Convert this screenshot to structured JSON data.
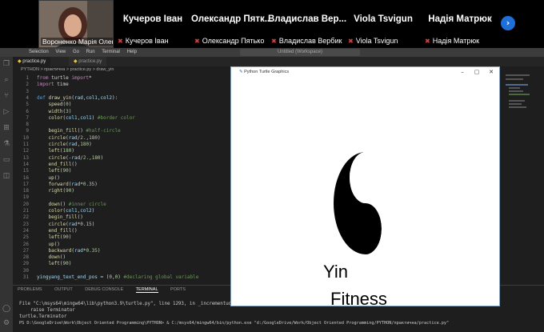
{
  "call": {
    "main_participant": "Вороненко Марія Олекса...",
    "participants": [
      {
        "name": "Кучеров Іван",
        "tag": "Кучеров Іван"
      },
      {
        "name": "Олександр Пятк...",
        "tag": "Олександр Пятько"
      },
      {
        "name": "Владислав Вер...",
        "tag": "Владислав Вербик"
      },
      {
        "name": "Viola Tsvigun",
        "tag": "Viola Tsvigun"
      },
      {
        "name": "Надія Матрюк",
        "tag": "Надія Матрюк"
      }
    ],
    "next_icon": "chevron-right-icon"
  },
  "vscode": {
    "menu": [
      "Selection",
      "View",
      "Go",
      "Run",
      "Terminal",
      "Help"
    ],
    "window_title": "Untitled (Workspace)",
    "tabs": [
      "practice.py",
      "practice.py"
    ],
    "breadcrumb": "PYTHON > практична > practice.py > draw_yin",
    "panel_tabs": [
      "PROBLEMS",
      "OUTPUT",
      "DEBUG CONSOLE",
      "TERMINAL",
      "PORTS"
    ],
    "terminal": [
      "File \"C:\\msys64\\mingw64\\lib\\python3.9\\turtle.py\", line 1293, in _incrementudc",
      "    raise Terminator",
      "turtle.Terminator",
      "PS D:\\GoogleDrive\\Work\\Object Oriented Programming\\PYTHON> & C:/msys64/mingw64/bin/python.exe \"d:/GoogleDrive/Work/Object Oriented Programming/PYTHON/практична/practice.py\""
    ]
  },
  "turtle": {
    "title": "Python Turtle Graphics",
    "text1": "Yin",
    "text2": "Fitness"
  },
  "code": [
    {
      "n": "1",
      "parts": [
        [
          "kw",
          "from "
        ],
        [
          "plain",
          "turtle "
        ],
        [
          "kw",
          "import"
        ],
        [
          "plain",
          "*"
        ]
      ]
    },
    {
      "n": "2",
      "parts": [
        [
          "kw",
          "import "
        ],
        [
          "plain",
          "time"
        ]
      ]
    },
    {
      "n": "3",
      "parts": []
    },
    {
      "n": "4",
      "parts": [
        [
          "df",
          "def "
        ],
        [
          "fn",
          "draw_yin"
        ],
        [
          "plain",
          "("
        ],
        [
          "var",
          "rad"
        ],
        [
          "plain",
          ","
        ],
        [
          "var",
          "col1"
        ],
        [
          "plain",
          ","
        ],
        [
          "var",
          "col2"
        ],
        [
          "plain",
          "):"
        ]
      ]
    },
    {
      "n": "5",
      "parts": [
        [
          "plain",
          "    "
        ],
        [
          "fn",
          "speed"
        ],
        [
          "plain",
          "("
        ],
        [
          "nm",
          "0"
        ],
        [
          "plain",
          ")"
        ]
      ]
    },
    {
      "n": "6",
      "parts": [
        [
          "plain",
          "    "
        ],
        [
          "fn",
          "width"
        ],
        [
          "plain",
          "("
        ],
        [
          "nm",
          "3"
        ],
        [
          "plain",
          ")"
        ]
      ]
    },
    {
      "n": "7",
      "parts": [
        [
          "plain",
          "    "
        ],
        [
          "fn",
          "color"
        ],
        [
          "plain",
          "("
        ],
        [
          "var",
          "col1"
        ],
        [
          "plain",
          ","
        ],
        [
          "var",
          "col1"
        ],
        [
          "plain",
          ") "
        ],
        [
          "cm",
          "#border color"
        ]
      ]
    },
    {
      "n": "8",
      "parts": []
    },
    {
      "n": "9",
      "parts": [
        [
          "plain",
          "    "
        ],
        [
          "fn",
          "begin_fill"
        ],
        [
          "plain",
          "() "
        ],
        [
          "cm",
          "#half-circle"
        ]
      ]
    },
    {
      "n": "10",
      "parts": [
        [
          "plain",
          "    "
        ],
        [
          "fn",
          "circle"
        ],
        [
          "plain",
          "("
        ],
        [
          "var",
          "rad"
        ],
        [
          "plain",
          "/"
        ],
        [
          "nm",
          "2."
        ],
        [
          "plain",
          ","
        ],
        [
          "nm",
          "180"
        ],
        [
          "plain",
          ")"
        ]
      ]
    },
    {
      "n": "11",
      "parts": [
        [
          "plain",
          "    "
        ],
        [
          "fn",
          "circle"
        ],
        [
          "plain",
          "("
        ],
        [
          "var",
          "rad"
        ],
        [
          "plain",
          ","
        ],
        [
          "nm",
          "180"
        ],
        [
          "plain",
          ")"
        ]
      ]
    },
    {
      "n": "12",
      "parts": [
        [
          "plain",
          "    "
        ],
        [
          "fn",
          "left"
        ],
        [
          "plain",
          "("
        ],
        [
          "nm",
          "180"
        ],
        [
          "plain",
          ")"
        ]
      ]
    },
    {
      "n": "13",
      "parts": [
        [
          "plain",
          "    "
        ],
        [
          "fn",
          "circle"
        ],
        [
          "plain",
          "(-"
        ],
        [
          "var",
          "rad"
        ],
        [
          "plain",
          "/"
        ],
        [
          "nm",
          "2."
        ],
        [
          "plain",
          ","
        ],
        [
          "nm",
          "180"
        ],
        [
          "plain",
          ")"
        ]
      ]
    },
    {
      "n": "14",
      "parts": [
        [
          "plain",
          "    "
        ],
        [
          "fn",
          "end_fill"
        ],
        [
          "plain",
          "()"
        ]
      ]
    },
    {
      "n": "15",
      "parts": [
        [
          "plain",
          "    "
        ],
        [
          "fn",
          "left"
        ],
        [
          "plain",
          "("
        ],
        [
          "nm",
          "90"
        ],
        [
          "plain",
          ")"
        ]
      ]
    },
    {
      "n": "16",
      "parts": [
        [
          "plain",
          "    "
        ],
        [
          "fn",
          "up"
        ],
        [
          "plain",
          "()"
        ]
      ]
    },
    {
      "n": "17",
      "parts": [
        [
          "plain",
          "    "
        ],
        [
          "fn",
          "forward"
        ],
        [
          "plain",
          "("
        ],
        [
          "var",
          "rad"
        ],
        [
          "plain",
          "*"
        ],
        [
          "nm",
          "0.35"
        ],
        [
          "plain",
          ")"
        ]
      ]
    },
    {
      "n": "18",
      "parts": [
        [
          "plain",
          "    "
        ],
        [
          "fn",
          "right"
        ],
        [
          "plain",
          "("
        ],
        [
          "nm",
          "90"
        ],
        [
          "plain",
          ")"
        ]
      ]
    },
    {
      "n": "19",
      "parts": []
    },
    {
      "n": "20",
      "parts": [
        [
          "plain",
          "    "
        ],
        [
          "fn",
          "down"
        ],
        [
          "plain",
          "() "
        ],
        [
          "cm",
          "#inner circle"
        ]
      ]
    },
    {
      "n": "21",
      "parts": [
        [
          "plain",
          "    "
        ],
        [
          "fn",
          "color"
        ],
        [
          "plain",
          "("
        ],
        [
          "var",
          "col1"
        ],
        [
          "plain",
          ","
        ],
        [
          "var",
          "col2"
        ],
        [
          "plain",
          ")"
        ]
      ]
    },
    {
      "n": "22",
      "parts": [
        [
          "plain",
          "    "
        ],
        [
          "fn",
          "begin_fill"
        ],
        [
          "plain",
          "()"
        ]
      ]
    },
    {
      "n": "23",
      "parts": [
        [
          "plain",
          "    "
        ],
        [
          "fn",
          "circle"
        ],
        [
          "plain",
          "("
        ],
        [
          "var",
          "rad"
        ],
        [
          "plain",
          "*"
        ],
        [
          "nm",
          "0.15"
        ],
        [
          "plain",
          ")"
        ]
      ]
    },
    {
      "n": "24",
      "parts": [
        [
          "plain",
          "    "
        ],
        [
          "fn",
          "end_fill"
        ],
        [
          "plain",
          "()"
        ]
      ]
    },
    {
      "n": "25",
      "parts": [
        [
          "plain",
          "    "
        ],
        [
          "fn",
          "left"
        ],
        [
          "plain",
          "("
        ],
        [
          "nm",
          "90"
        ],
        [
          "plain",
          ")"
        ]
      ]
    },
    {
      "n": "26",
      "parts": [
        [
          "plain",
          "    "
        ],
        [
          "fn",
          "up"
        ],
        [
          "plain",
          "()"
        ]
      ]
    },
    {
      "n": "27",
      "parts": [
        [
          "plain",
          "    "
        ],
        [
          "fn",
          "backward"
        ],
        [
          "plain",
          "("
        ],
        [
          "var",
          "rad"
        ],
        [
          "plain",
          "*"
        ],
        [
          "nm",
          "0.35"
        ],
        [
          "plain",
          ")"
        ]
      ]
    },
    {
      "n": "28",
      "parts": [
        [
          "plain",
          "    "
        ],
        [
          "fn",
          "down"
        ],
        [
          "plain",
          "()"
        ]
      ]
    },
    {
      "n": "29",
      "parts": [
        [
          "plain",
          "    "
        ],
        [
          "fn",
          "left"
        ],
        [
          "plain",
          "("
        ],
        [
          "nm",
          "90"
        ],
        [
          "plain",
          ")"
        ]
      ]
    },
    {
      "n": "30",
      "parts": []
    },
    {
      "n": "31",
      "parts": [
        [
          "var",
          "yingyang_text_end_pos"
        ],
        [
          "plain",
          " = ("
        ],
        [
          "nm",
          "0"
        ],
        [
          "plain",
          ","
        ],
        [
          "nm",
          "0"
        ],
        [
          "plain",
          ") "
        ],
        [
          "cm",
          "#declaring global variable"
        ]
      ]
    }
  ]
}
